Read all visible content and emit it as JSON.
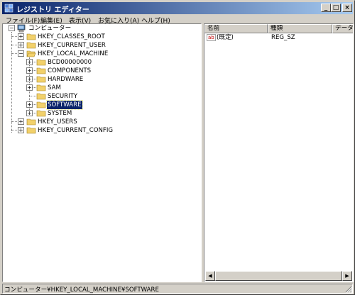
{
  "window": {
    "title": "レジストリ エディター",
    "caption_buttons": {
      "minimize": "_",
      "maximize": "□",
      "close": "×"
    }
  },
  "menu": [
    "ファイル(F)",
    "編集(E)",
    "表示(V)",
    "お気に入り(A)",
    "ヘルプ(H)"
  ],
  "tree": {
    "root": "コンピューター",
    "hives": [
      "HKEY_CLASSES_ROOT",
      "HKEY_CURRENT_USER",
      "HKEY_LOCAL_MACHINE",
      "HKEY_USERS",
      "HKEY_CURRENT_CONFIG"
    ],
    "hklm_children": [
      "BCD00000000",
      "COMPONENTS",
      "HARDWARE",
      "SAM",
      "SECURITY",
      "SOFTWARE",
      "SYSTEM"
    ],
    "selected": "SOFTWARE"
  },
  "list": {
    "columns": [
      "名前",
      "種類",
      "データ"
    ],
    "rows": [
      {
        "icon": "ab",
        "name": "(既定)",
        "type": "REG_SZ",
        "data": ""
      }
    ]
  },
  "status": {
    "path": "コンピューター¥HKEY_LOCAL_MACHINE¥SOFTWARE"
  },
  "colors": {
    "title_start": "#0a246a",
    "title_end": "#a6caf0",
    "selection": "#0a246a",
    "folder": "#f2d16b"
  },
  "icons": [
    "regedit-icon",
    "computer-icon",
    "folder-icon",
    "string-value-icon",
    "expand-plus-icon",
    "collapse-minus-icon"
  ]
}
